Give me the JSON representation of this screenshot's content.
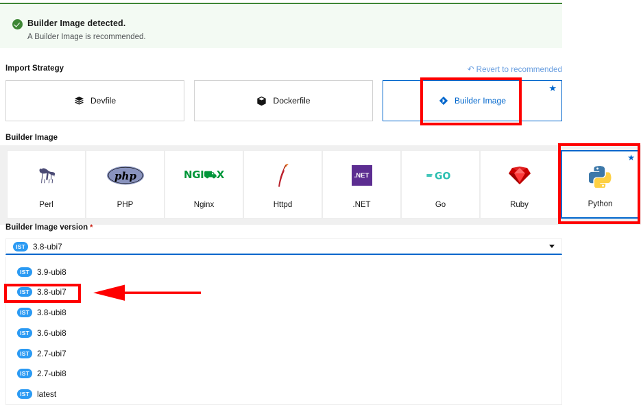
{
  "alert": {
    "icon": "check-circle-icon",
    "title": "Builder Image detected.",
    "subtitle": "A Builder Image is recommended."
  },
  "import_strategy": {
    "label": "Import Strategy",
    "revert_label": "Revert to recommended",
    "revert_icon": "undo-icon",
    "selected": "Builder Image",
    "options": [
      {
        "label": "Devfile",
        "icon": "layers-icon",
        "selected": false,
        "starred": false
      },
      {
        "label": "Dockerfile",
        "icon": "cube-icon",
        "selected": false,
        "starred": false
      },
      {
        "label": "Builder Image",
        "icon": "builder-icon",
        "selected": true,
        "starred": true
      }
    ]
  },
  "builder_image": {
    "label": "Builder Image",
    "selected": "Python",
    "options": [
      {
        "label": "Perl",
        "icon": "perl-camel-icon",
        "selected": false,
        "starred": false
      },
      {
        "label": "PHP",
        "icon": "php-icon",
        "selected": false,
        "starred": false
      },
      {
        "label": "Nginx",
        "icon": "nginx-icon",
        "selected": false,
        "starred": false
      },
      {
        "label": "Httpd",
        "icon": "apache-httpd-icon",
        "selected": false,
        "starred": false
      },
      {
        "label": ".NET",
        "icon": "dotnet-icon",
        "selected": false,
        "starred": false
      },
      {
        "label": "Go",
        "icon": "golang-icon",
        "selected": false,
        "starred": false
      },
      {
        "label": "Ruby",
        "icon": "ruby-gem-icon",
        "selected": false,
        "starred": false
      },
      {
        "label": "Python",
        "icon": "python-icon",
        "selected": true,
        "starred": true
      }
    ]
  },
  "builder_image_version": {
    "label": "Builder Image version",
    "required_marker": "*",
    "badge": "IST",
    "selected_value": "3.8-ubi7",
    "caret_icon": "chevron-down-icon",
    "options": [
      {
        "badge": "IST",
        "label": "3.9-ubi8"
      },
      {
        "badge": "IST",
        "label": "3.8-ubi7"
      },
      {
        "badge": "IST",
        "label": "3.8-ubi8"
      },
      {
        "badge": "IST",
        "label": "3.6-ubi8"
      },
      {
        "badge": "IST",
        "label": "2.7-ubi7"
      },
      {
        "badge": "IST",
        "label": "2.7-ubi8"
      },
      {
        "badge": "IST",
        "label": "latest"
      }
    ]
  },
  "annotations": {
    "color": "#fe0000",
    "boxes": [
      "builder-image-strategy-card",
      "python-builder-card",
      "3.8-ubi7-dropdown-option"
    ],
    "arrow": "points-left-to-3.8-ubi7-option"
  },
  "colors": {
    "accent_blue": "#06c",
    "success_green": "#3e8635",
    "alert_bg": "#f3faf3",
    "gallery_bg": "#f0f0f0",
    "badge_blue": "#2b9af3",
    "annotation_red": "#fe0000",
    "required_red": "#c9190b"
  }
}
